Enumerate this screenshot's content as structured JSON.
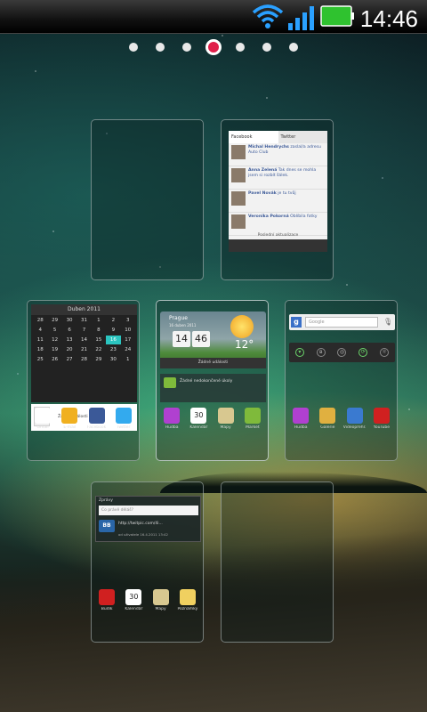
{
  "status_bar": {
    "time": "14:46"
  },
  "pager": {
    "count": 7,
    "active_index": 3
  },
  "screens": {
    "facebook": {
      "tabs": [
        "Facebook",
        "Twitter"
      ],
      "posts": [
        {
          "author": "Michal Hendrychs",
          "text": "zaslal/a adresu Auto Club"
        },
        {
          "author": "Anna Zelená",
          "text": "Tak dnes se mohla jsem si rozbít šálek."
        },
        {
          "author": "Pavel Novák",
          "text": "je tu tvůj"
        },
        {
          "author": "Veronika Pokorná",
          "text": "Oblíbila fotky"
        }
      ],
      "updated": "Poslední aktualizace"
    },
    "calendar": {
      "month": "Duben 2011",
      "rows": [
        [
          "28",
          "29",
          "30",
          "31",
          "1",
          "2",
          "3"
        ],
        [
          "4",
          "5",
          "6",
          "7",
          "8",
          "9",
          "10"
        ],
        [
          "11",
          "12",
          "13",
          "14",
          "15",
          "16",
          "17"
        ],
        [
          "18",
          "19",
          "20",
          "21",
          "22",
          "23",
          "24"
        ],
        [
          "25",
          "26",
          "27",
          "28",
          "29",
          "30",
          "1"
        ]
      ],
      "today": "16",
      "today_label": "Duben",
      "event": "Žádné události",
      "dock": [
        {
          "label": "Gmail",
          "icon": "mail-icon",
          "color": "#ffffff"
        },
        {
          "label": "E-mail",
          "icon": "email-icon",
          "color": "#f0b020"
        },
        {
          "label": "Facebook",
          "icon": "facebook-icon",
          "color": "#3b5998"
        },
        {
          "label": "Twitter",
          "icon": "twitter-icon",
          "color": "#33aaee"
        }
      ]
    },
    "weather": {
      "city": "Prague",
      "date": "16 duben 2011",
      "hour": "14",
      "minute": "46",
      "temp": "12°",
      "alarm": "Žádné události",
      "tasks": "Žádné nedokončené úkoly",
      "dock": [
        {
          "label": "Hudba",
          "icon": "music-icon",
          "color": "#b040d0"
        },
        {
          "label": "Kalendář",
          "icon": "calendar-icon",
          "color": "#ffffff",
          "text": "30"
        },
        {
          "label": "Mapy",
          "icon": "maps-icon",
          "color": "#d8c890"
        },
        {
          "label": "Market",
          "icon": "market-icon",
          "color": "#7fba3b"
        }
      ]
    },
    "google": {
      "placeholder": "Google",
      "dock": [
        {
          "label": "Hudba",
          "icon": "music-icon",
          "color": "#b040d0"
        },
        {
          "label": "Galerie",
          "icon": "gallery-icon",
          "color": "#e0b040"
        },
        {
          "label": "Videopřehr.",
          "icon": "video-icon",
          "color": "#3a7ad0"
        },
        {
          "label": "YouTube",
          "icon": "youtube-icon",
          "color": "#d02020"
        }
      ]
    },
    "messages": {
      "title": "Zprávy",
      "input_placeholder": "Co právě děláš?",
      "logo": "BB",
      "url": "http://twitpic.com/4i...",
      "meta": "od uživatele 16.4.2011 13:42",
      "dock": [
        {
          "label": "Budík",
          "icon": "alarm-icon",
          "color": "#d02020"
        },
        {
          "label": "Kalendář",
          "icon": "calendar-icon",
          "color": "#ffffff",
          "text": "30"
        },
        {
          "label": "Mapy",
          "icon": "maps-icon",
          "color": "#d8c890"
        },
        {
          "label": "Poznámky",
          "icon": "notes-icon",
          "color": "#f0d060"
        }
      ]
    }
  }
}
